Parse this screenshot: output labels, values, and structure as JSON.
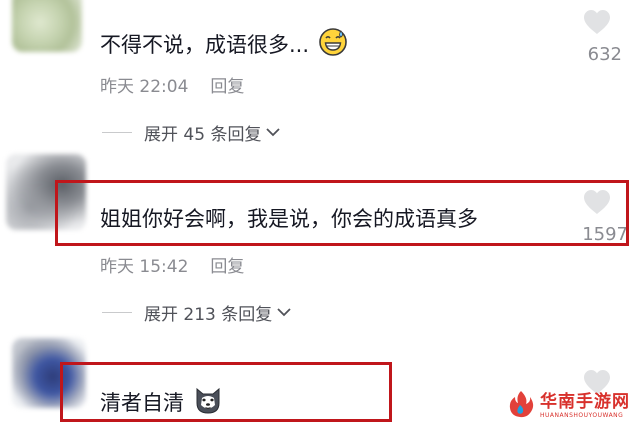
{
  "colors": {
    "text": "#161823",
    "meta": "#8a8b91",
    "expand": "#505259",
    "highlight_border": "#c0161b",
    "heart": "#e1e2e4",
    "watermark": "#d8312c"
  },
  "comments": [
    {
      "text": "不得不说，成语很多...",
      "emoji_icon": "grinning-sweat-emoji-icon",
      "time": "昨天 22:04",
      "reply_label": "回复",
      "expand_label": "展开 45 条回复",
      "likes": "632",
      "highlighted": false
    },
    {
      "text": "姐姐你好会啊，我是说，你会的成语真多",
      "time": "昨天 15:42",
      "reply_label": "回复",
      "expand_label": "展开 213 条回复",
      "likes": "1597",
      "highlighted": true
    },
    {
      "text": "清者自清",
      "emoji_icon": "husky-dog-emoji-icon",
      "highlighted": true
    }
  ],
  "watermark": {
    "name": "华南手游网",
    "subtitle": "HUANANSHOUYOUWANG",
    "logo_icon": "flame-logo-icon"
  }
}
